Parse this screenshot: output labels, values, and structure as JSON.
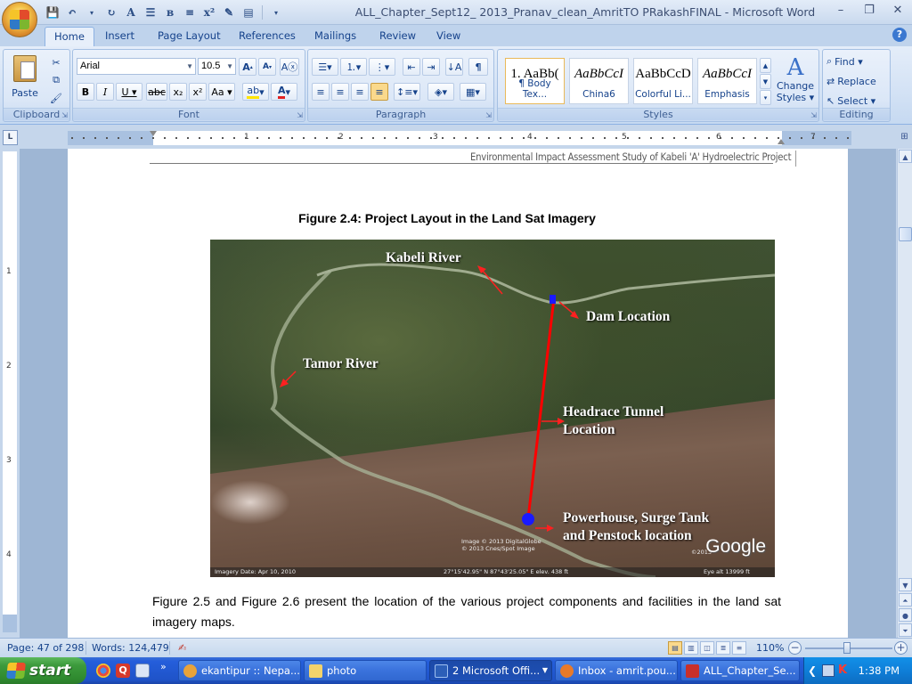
{
  "window": {
    "title": "ALL_Chapter_Sept12_ 2013_Pranav_clean_AmritTO PRakashFINAL - Microsoft Word",
    "controls": [
      "–",
      "❐",
      "✕"
    ]
  },
  "ribbon": {
    "tabs": [
      "Home",
      "Insert",
      "Page Layout",
      "References",
      "Mailings",
      "Review",
      "View"
    ],
    "active_tab": "Home",
    "clipboard": {
      "paste_label": "Paste",
      "group_label": "Clipboard"
    },
    "font": {
      "name": "Arial",
      "size": "10.5",
      "group_label": "Font"
    },
    "paragraph": {
      "group_label": "Paragraph"
    },
    "styles": {
      "group_label": "Styles",
      "tiles": [
        {
          "sample": "1. AaBb(",
          "name": "¶ Body Tex..."
        },
        {
          "sample": "AaBbCcI",
          "name": "China6"
        },
        {
          "sample": "AaBbCcD",
          "name": "Colorful Li..."
        },
        {
          "sample": "AaBbCcI",
          "name": "Emphasis"
        }
      ],
      "change_styles_line1": "Change",
      "change_styles_line2": "Styles ▾"
    },
    "editing": {
      "group_label": "Editing",
      "find": "Find ▾",
      "replace": "Replace",
      "select": "Select ▾"
    }
  },
  "ruler": {
    "corner": "L",
    "h_numbers": [
      "1",
      "2",
      "3",
      "4",
      "5",
      "6",
      "7"
    ],
    "v_numbers": [
      "1",
      "2",
      "3",
      "4"
    ]
  },
  "document": {
    "header": "Environmental Impact Assessment Study of Kabeli 'A' Hydroelectric Project",
    "figure_caption": "Figure 2.4: Project Layout in the Land Sat Imagery",
    "map_labels": {
      "kabeli": "Kabeli River",
      "dam": "Dam Location",
      "tamor": "Tamor River",
      "headrace_1": "Headrace Tunnel",
      "headrace_2": "Location",
      "powerhouse_1": "Powerhouse, Surge Tank",
      "powerhouse_2": "and Penstock location",
      "google": "Google",
      "imagery_date": "Imagery Date: Apr 10, 2010",
      "coords": "27°15'42.95\" N    87°43'25.05\" E    elev. 438 ft",
      "eye_alt": "Eye alt  13999 ft",
      "copyright_1": "Image © 2013 DigitalGlobe",
      "copyright_2": "© 2013 Cnes/Spot Image",
      "copyright_year": "©2013"
    },
    "body_text": "Figure 2.5 and Figure 2.6 present the location of the various project components and facilities in the land sat imagery maps."
  },
  "statusbar": {
    "page": "Page: 47 of 298",
    "words": "Words: 124,479",
    "zoom": "110%"
  },
  "taskbar": {
    "start": "start",
    "buttons": [
      {
        "label": "ekantipur :: Nepa...",
        "icon_color": "#e8a33a"
      },
      {
        "label": "photo",
        "icon_color": "#f3d36b"
      },
      {
        "label": "2 Microsoft Offi...",
        "icon_color": "#2c5fb8"
      },
      {
        "label": "Inbox - amrit.pou...",
        "icon_color": "#e87a2a"
      },
      {
        "label": "ALL_Chapter_Se...",
        "icon_color": "#c8302a"
      }
    ],
    "time": "1:38 PM"
  }
}
